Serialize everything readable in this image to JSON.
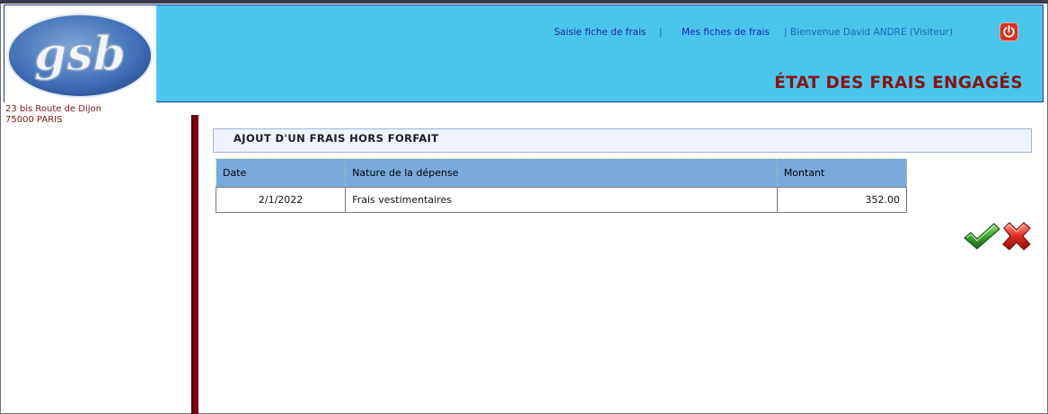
{
  "header": {
    "logo_text": "gsb",
    "nav": {
      "saisie": "Saisie fiche de frais",
      "sep1": "|",
      "mes_fiches": "Mes fiches de frais",
      "welcome": "| Bienvenue David ANDRE (Visiteur)"
    },
    "logout_icon": "power-icon",
    "title": "ÉTAT DES FRAIS ENGAGÉS"
  },
  "address": {
    "line1": "23 bis Route de Dijon",
    "line2": "75000 PARIS"
  },
  "section": {
    "title": "AJOUT D'UN FRAIS HORS FORFAIT"
  },
  "table": {
    "headers": [
      "Date",
      "Nature de la dépense",
      "Montant"
    ],
    "rows": [
      [
        "2/1/2022",
        "Frais vestimentaires",
        "352.00"
      ]
    ]
  },
  "actions": {
    "validate_icon": "checkmark-icon",
    "cancel_icon": "cross-icon"
  },
  "colors": {
    "header_bg": "#4ac6ec",
    "title_red": "#8b1313",
    "table_header_bg": "#78aadd",
    "side_bar": "#8b0000"
  }
}
